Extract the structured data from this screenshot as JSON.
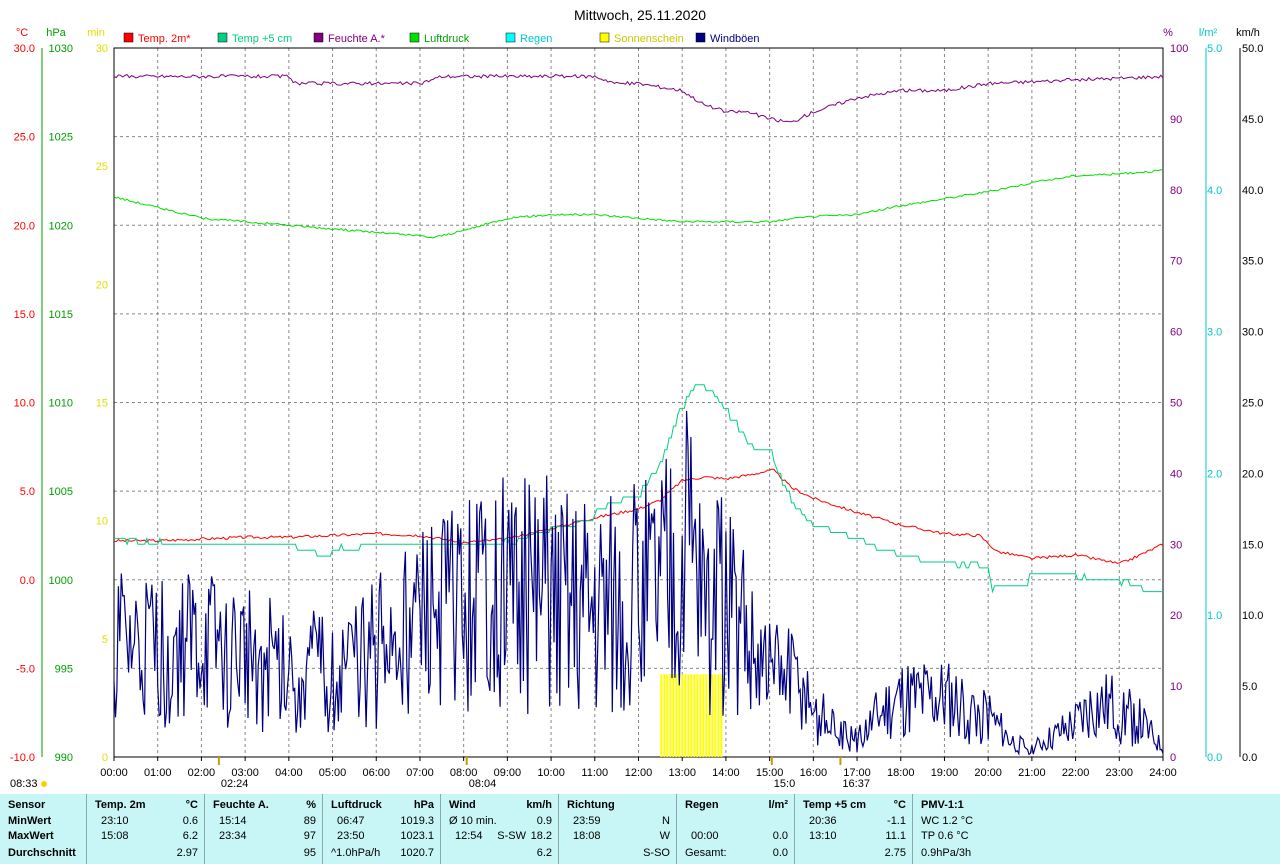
{
  "chart_data": {
    "type": "line",
    "title": "Mittwoch, 25.11.2020",
    "x_ticks": [
      "00:00",
      "01:00",
      "02:00",
      "03:00",
      "04:00",
      "05:00",
      "06:00",
      "07:00",
      "08:00",
      "09:00",
      "10:00",
      "11:00",
      "12:00",
      "13:00",
      "14:00",
      "15:00",
      "16:00",
      "17:00",
      "18:00",
      "19:00",
      "20:00",
      "21:00",
      "22:00",
      "23:00",
      "24:00"
    ],
    "xlim": [
      0,
      24
    ],
    "axes": {
      "temp": {
        "unit": "°C",
        "range": [
          -10,
          30
        ],
        "ticks": [
          "-10.0",
          "-5.0",
          "0.0",
          "5.0",
          "10.0",
          "15.0",
          "20.0",
          "25.0",
          "30.0"
        ],
        "color": "#ff0000"
      },
      "pressure": {
        "unit": "hPa",
        "range": [
          990,
          1030
        ],
        "ticks": [
          "990",
          "995",
          "1000",
          "1005",
          "1010",
          "1015",
          "1020",
          "1025",
          "1030"
        ],
        "color": "#00a000"
      },
      "sun": {
        "unit": "min",
        "range": [
          0,
          30
        ],
        "ticks": [
          "0",
          "5",
          "10",
          "15",
          "20",
          "25",
          "30"
        ],
        "color": "#e0e000"
      },
      "humidity": {
        "unit": "%",
        "range": [
          0,
          100
        ],
        "ticks": [
          "0",
          "10",
          "20",
          "30",
          "40",
          "50",
          "60",
          "70",
          "80",
          "90",
          "100"
        ],
        "color": "#800080"
      },
      "rain": {
        "unit": "l/m²",
        "range": [
          0,
          5
        ],
        "ticks": [
          "0.0",
          "1.0",
          "2.0",
          "3.0",
          "4.0",
          "5.0"
        ],
        "color": "#00c8c8"
      },
      "wind": {
        "unit": "km/h",
        "range": [
          0,
          50
        ],
        "ticks": [
          "0.0",
          "5.0",
          "10.0",
          "15.0",
          "20.0",
          "25.0",
          "30.0",
          "35.0",
          "40.0",
          "45.0",
          "50.0"
        ],
        "color": "#000000"
      }
    },
    "legend": [
      {
        "name": "Temp. 2m*",
        "color": "#ff0000"
      },
      {
        "name": "Temp +5 cm",
        "color": "#00d080"
      },
      {
        "name": "Feuchte A.*",
        "color": "#800080"
      },
      {
        "name": "Luftdruck",
        "color": "#00e000"
      },
      {
        "name": "Regen",
        "color": "#00ffff"
      },
      {
        "name": "Sonnenschein",
        "color": "#ffff00"
      },
      {
        "name": "Windböen",
        "color": "#000080"
      }
    ],
    "series": [
      {
        "name": "Temp. 2m*",
        "axis": "temp",
        "color": "#ff0000",
        "points": [
          [
            0,
            2.2
          ],
          [
            1,
            2.2
          ],
          [
            2,
            2.3
          ],
          [
            3,
            2.4
          ],
          [
            4,
            2.4
          ],
          [
            5,
            2.5
          ],
          [
            6,
            2.6
          ],
          [
            7,
            2.5
          ],
          [
            8,
            2.1
          ],
          [
            9,
            2.3
          ],
          [
            10,
            2.9
          ],
          [
            11,
            3.5
          ],
          [
            12,
            4.0
          ],
          [
            12.5,
            4.5
          ],
          [
            13,
            5.6
          ],
          [
            13.5,
            5.8
          ],
          [
            14,
            5.7
          ],
          [
            14.5,
            5.9
          ],
          [
            15.08,
            6.2
          ],
          [
            15.5,
            5.2
          ],
          [
            16,
            4.6
          ],
          [
            16.5,
            4.2
          ],
          [
            17,
            3.8
          ],
          [
            18,
            3.1
          ],
          [
            19,
            2.6
          ],
          [
            19.8,
            2.5
          ],
          [
            20.2,
            1.6
          ],
          [
            21,
            1.2
          ],
          [
            22,
            1.4
          ],
          [
            23,
            0.9
          ],
          [
            23.3,
            1.2
          ],
          [
            24,
            2.0
          ]
        ]
      },
      {
        "name": "Temp +5 cm",
        "axis": "temp",
        "color": "#00d080",
        "points": [
          [
            0,
            2.2
          ],
          [
            1,
            2.1
          ],
          [
            2,
            2.0
          ],
          [
            3,
            2.0
          ],
          [
            4,
            2.1
          ],
          [
            4.8,
            1.2
          ],
          [
            5,
            1.8
          ],
          [
            6,
            1.9
          ],
          [
            7,
            2.0
          ],
          [
            8,
            2.0
          ],
          [
            9,
            2.2
          ],
          [
            10,
            2.8
          ],
          [
            11,
            3.8
          ],
          [
            12,
            5.0
          ],
          [
            12.5,
            6.5
          ],
          [
            13,
            10.0
          ],
          [
            13.3,
            11.1
          ],
          [
            13.7,
            10.5
          ],
          [
            14,
            9.5
          ],
          [
            14.5,
            7.6
          ],
          [
            15,
            7.2
          ],
          [
            15.5,
            4.4
          ],
          [
            16,
            3.0
          ],
          [
            17,
            2.2
          ],
          [
            18,
            1.3
          ],
          [
            19,
            0.9
          ],
          [
            20,
            0.8
          ],
          [
            20.1,
            -0.5
          ],
          [
            20.7,
            -0.5
          ],
          [
            21,
            0.3
          ],
          [
            22,
            0.2
          ],
          [
            23,
            -0.1
          ],
          [
            23.6,
            -0.6
          ],
          [
            24,
            -0.6
          ]
        ]
      },
      {
        "name": "Feuchte A.*",
        "axis": "humidity",
        "color": "#800080",
        "points": [
          [
            0,
            96
          ],
          [
            4,
            96
          ],
          [
            4.1,
            95
          ],
          [
            7,
            95
          ],
          [
            7.5,
            96
          ],
          [
            11,
            96
          ],
          [
            11.5,
            95
          ],
          [
            12,
            95
          ],
          [
            13,
            94
          ],
          [
            13.5,
            92
          ],
          [
            14,
            91
          ],
          [
            14.5,
            91
          ],
          [
            15,
            90
          ],
          [
            15.5,
            89.5
          ],
          [
            16,
            91
          ],
          [
            17,
            93
          ],
          [
            18,
            94
          ],
          [
            19,
            94
          ],
          [
            20,
            95
          ],
          [
            22,
            95.5
          ],
          [
            24,
            96
          ]
        ]
      },
      {
        "name": "Luftdruck",
        "axis": "pressure",
        "color": "#00e000",
        "points": [
          [
            0,
            1021.6
          ],
          [
            1,
            1021.0
          ],
          [
            2,
            1020.4
          ],
          [
            3,
            1020.2
          ],
          [
            4,
            1020.0
          ],
          [
            5,
            1019.8
          ],
          [
            6,
            1019.6
          ],
          [
            7,
            1019.4
          ],
          [
            7.3,
            1019.3
          ],
          [
            8,
            1019.7
          ],
          [
            9,
            1020.4
          ],
          [
            10,
            1020.6
          ],
          [
            11,
            1020.6
          ],
          [
            12,
            1020.4
          ],
          [
            13,
            1020.2
          ],
          [
            14,
            1020.2
          ],
          [
            15,
            1020.2
          ],
          [
            16,
            1020.5
          ],
          [
            17,
            1020.6
          ],
          [
            18,
            1021.1
          ],
          [
            19,
            1021.5
          ],
          [
            20,
            1021.9
          ],
          [
            21,
            1022.4
          ],
          [
            22,
            1022.8
          ],
          [
            23,
            1022.9
          ],
          [
            24,
            1023.1
          ]
        ]
      },
      {
        "name": "Windböen",
        "axis": "wind",
        "color": "#000080",
        "random_seed": 7,
        "envelope": [
          [
            0,
            13
          ],
          [
            2,
            13
          ],
          [
            3,
            12
          ],
          [
            5,
            10
          ],
          [
            6,
            13
          ],
          [
            7,
            16
          ],
          [
            8,
            18
          ],
          [
            9,
            20
          ],
          [
            10,
            20
          ],
          [
            11,
            20
          ],
          [
            12,
            20
          ],
          [
            12.9,
            24
          ],
          [
            13.2,
            26
          ],
          [
            13.5,
            20
          ],
          [
            14,
            18
          ],
          [
            14.5,
            14
          ],
          [
            15,
            10
          ],
          [
            15.5,
            9
          ],
          [
            16,
            6
          ],
          [
            16.5,
            3
          ],
          [
            17,
            2
          ],
          [
            17.5,
            5
          ],
          [
            18,
            7
          ],
          [
            19,
            7
          ],
          [
            20,
            5
          ],
          [
            20.5,
            2
          ],
          [
            21,
            1
          ],
          [
            22,
            4
          ],
          [
            22.4,
            6
          ],
          [
            23,
            6
          ],
          [
            23.5,
            4
          ],
          [
            24,
            1
          ]
        ]
      }
    ],
    "sunshine": {
      "axis": "sun",
      "color": "#ffff00",
      "intervals": [
        [
          12.5,
          13.9
        ]
      ],
      "values": [
        3.5
      ]
    },
    "markers": [
      {
        "label": "02:24",
        "x": 2.4
      },
      {
        "label": "08:04",
        "x": 8.07
      },
      {
        "label": "15:0",
        "x": 15.05
      },
      {
        "label": "16:37",
        "x": 16.62
      }
    ],
    "sunrise_label": "08:33"
  },
  "stats": {
    "sensor": {
      "header": "Sensor",
      "rows": [
        "MinWert",
        "MaxWert",
        "Durchschnitt"
      ]
    },
    "temp2m": {
      "header": "Temp. 2m",
      "unit": "°C",
      "min_time": "23:10",
      "min": "0.6",
      "max_time": "15:08",
      "max": "6.2",
      "avg": "2.97"
    },
    "feuchte": {
      "header": "Feuchte A.",
      "unit": "%",
      "min_time": "15:14",
      "min": "89",
      "max_time": "23:34",
      "max": "97",
      "avg": "95"
    },
    "luftdruck": {
      "header": "Luftdruck",
      "unit": "hPa",
      "min_time": "06:47",
      "min": "1019.3",
      "max_time": "23:50",
      "max": "1023.1",
      "avg_label": "^1.0hPa/h",
      "avg": "1020.7"
    },
    "wind": {
      "header": "Wind",
      "unit": "km/h",
      "row1_label": "Ø 10 min.",
      "row1": "0.9",
      "row2_time": "12:54",
      "row2_dir": "S-SW",
      "row2": "18.2",
      "avg": "6.2"
    },
    "richtung": {
      "header": "Richtung",
      "row1_time": "23:59",
      "row1": "N",
      "row2_time": "18:08",
      "row2": "W",
      "avg": "S-SO"
    },
    "regen": {
      "header": "Regen",
      "unit": "l/m²",
      "row2_time": "00:00",
      "row2": "0.0",
      "total_label": "Gesamt:",
      "total": "0.0"
    },
    "temp5cm": {
      "header": "Temp +5 cm",
      "unit": "°C",
      "min_time": "20:36",
      "min": "-1.1",
      "max_time": "13:10",
      "max": "11.1",
      "avg": "2.75"
    },
    "pmv": {
      "header": "PMV-1:1",
      "row1": "WC 1.2 °C",
      "row2": "TP 0.6 °C",
      "row3": "0.9hPa/3h"
    }
  }
}
